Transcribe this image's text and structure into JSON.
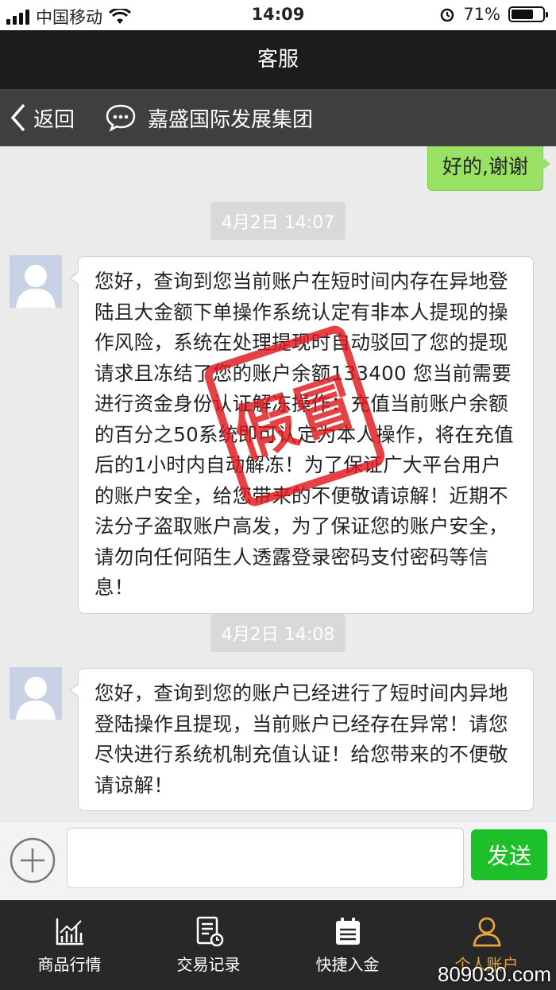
{
  "status_bar": {
    "carrier": "中国移动",
    "time": "14:09",
    "battery": "71%",
    "battery_level": 0.71
  },
  "header": {
    "title": "客服"
  },
  "nav": {
    "back_label": "返回",
    "chat_name": "嘉盛国际发展集团"
  },
  "messages": {
    "sent_1": "好的,谢谢",
    "time_1": "4月2日 14:07",
    "recv_1": "您好，查询到您当前账户在短时间内存在异地登陆且大金额下单操作系统认定有非本人提现的操作风险，系统在处理提现时自动驳回了您的提现请求且冻结了您的账户余额133400 您当前需要进行资金身份认证解冻操作：充值当前账户余额的百分之50系统即可认定为本人操作，将在充值后的1小时内自动解冻！为了保证广大平台用户的账户安全，给您带来的不便敬请谅解！近期不法分子盗取账户高发，为了保证您的账户安全，请勿向任何陌生人透露登录密码支付密码等信息！",
    "time_2": "4月2日 14:08",
    "recv_2": "您好，查询到您的账户已经进行了短时间内异地登陆操作且提现，当前账户已经存在异常！请您尽快进行系统机制充值认证！给您带来的不便敬请谅解！"
  },
  "stamp": {
    "text": "假冒",
    "color": "#e0191f"
  },
  "input": {
    "send_label": "发送",
    "placeholder": ""
  },
  "tabs": [
    {
      "label": "商品行情",
      "icon": "chart-icon"
    },
    {
      "label": "交易记录",
      "icon": "record-icon"
    },
    {
      "label": "快捷入金",
      "icon": "calendar-icon"
    },
    {
      "label": "个人账户",
      "icon": "user-icon"
    }
  ],
  "watermark": "809030.com",
  "colors": {
    "accent_green": "#1ec02a",
    "bubble_green": "#98e165",
    "tab_active": "#e8a33a"
  }
}
